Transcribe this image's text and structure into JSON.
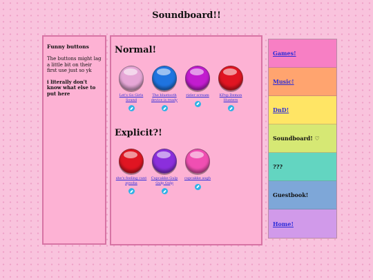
{
  "header": {
    "title": "Soundboard!!"
  },
  "sidebar": {
    "heading": "Funny buttons",
    "note": "The buttons might lag a little bit on their first use just so yk",
    "bold_note": "i literally don't know what else to put here"
  },
  "main": {
    "normal_title": "Normal!",
    "explicit_title": "Explicit?!",
    "normal_buttons": [
      {
        "label": "Let's Go Girls Sound",
        "color": "#e6a6d6"
      },
      {
        "label": "The bluetooth device is ready",
        "color": "#1f74e0"
      },
      {
        "label": "rizler scream",
        "color": "#c21ccf"
      },
      {
        "label": "KPop Demon Hunters",
        "color": "#e01522"
      }
    ],
    "explicit_buttons": [
      {
        "label": "she's feeling cunt aysoha",
        "color": "#e01522"
      },
      {
        "label": "Cupcakke Gulp Gulp Gulp",
        "color": "#8b2fdc"
      },
      {
        "label": "cupcakke augh",
        "color": "#f04fb2"
      }
    ],
    "link_icon": "link-icon"
  },
  "nav": {
    "items": [
      {
        "label": "Games!",
        "color": "#f77fc4",
        "link": true
      },
      {
        "label": "Music!",
        "color": "#ffa46f",
        "link": true
      },
      {
        "label": "DnD!",
        "color": "#ffe565",
        "link": true
      },
      {
        "label": "Soundboard! ♡",
        "color": "#d6e874",
        "link": false
      },
      {
        "label": "???",
        "color": "#63d5c1",
        "link": false
      },
      {
        "label": "Guestbook!",
        "color": "#7ea7d8",
        "link": false
      },
      {
        "label": "Home!",
        "color": "#d19aea",
        "link": true
      }
    ]
  }
}
